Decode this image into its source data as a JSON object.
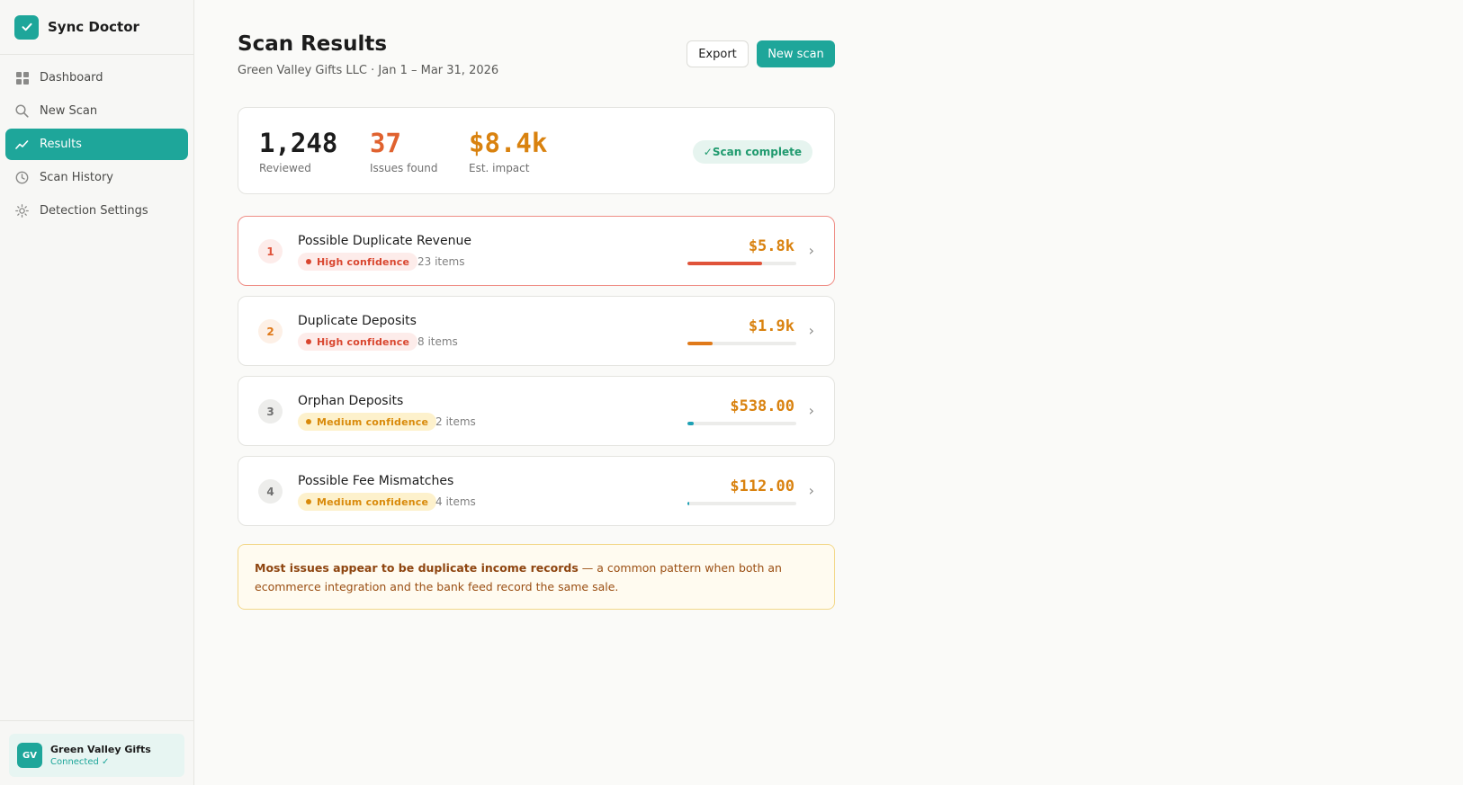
{
  "app": {
    "name": "Sync Doctor"
  },
  "sidebar": {
    "items": [
      {
        "label": "Dashboard",
        "icon": "grid-icon",
        "active": false
      },
      {
        "label": "New Scan",
        "icon": "search-icon",
        "active": false
      },
      {
        "label": "Results",
        "icon": "trend-icon",
        "active": true
      },
      {
        "label": "Scan History",
        "icon": "clock-icon",
        "active": false
      },
      {
        "label": "Detection Settings",
        "icon": "gear-icon",
        "active": false
      }
    ]
  },
  "account": {
    "initials": "GV",
    "name": "Green Valley Gifts",
    "status": "Connected ✓"
  },
  "header": {
    "title": "Scan Results",
    "subtitle": "Green Valley Gifts LLC · Jan 1 – Mar 31, 2026",
    "export_label": "Export",
    "new_scan_label": "New scan"
  },
  "stats": {
    "reviewed": {
      "value": "1,248",
      "label": "Reviewed"
    },
    "issues": {
      "value": "37",
      "label": "Issues found"
    },
    "impact": {
      "value": "$8.4k",
      "label": "Est. impact"
    },
    "status": "✓Scan complete"
  },
  "colors": {
    "accent": "#1ea69a",
    "high": "#d9462f",
    "medium": "#d98a0a",
    "impact": "#d9820f",
    "issues": "#e0622f"
  },
  "issues": [
    {
      "num": "1",
      "title": "Possible Duplicate Revenue",
      "confidence": "High confidence",
      "level": "high",
      "items": "23 items",
      "amount": "$5.8k",
      "share": 0.69,
      "bar_color": "#e0533a"
    },
    {
      "num": "2",
      "title": "Duplicate Deposits",
      "confidence": "High confidence",
      "level": "high",
      "items": "8 items",
      "amount": "$1.9k",
      "share": 0.23,
      "bar_color": "#e07a1a"
    },
    {
      "num": "3",
      "title": "Orphan Deposits",
      "confidence": "Medium confidence",
      "level": "medium",
      "items": "2 items",
      "amount": "$538.00",
      "share": 0.06,
      "bar_color": "#1ea1b5"
    },
    {
      "num": "4",
      "title": "Possible Fee Mismatches",
      "confidence": "Medium confidence",
      "level": "medium",
      "items": "4 items",
      "amount": "$112.00",
      "share": 0.013,
      "bar_color": "#1ea1b5"
    }
  ],
  "note": {
    "bold": "Most issues appear to be duplicate income records",
    "rest": " — a common pattern when both an ecommerce integration and the bank feed record the same sale."
  }
}
